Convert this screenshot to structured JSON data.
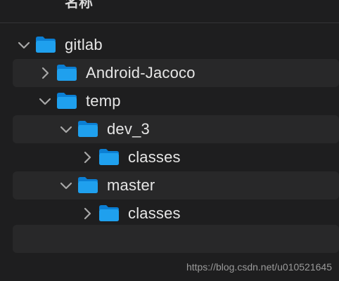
{
  "header": {
    "column_label": "名称"
  },
  "tree": {
    "items": [
      {
        "label": "gitlab",
        "expanded": true,
        "depth": 0
      },
      {
        "label": "Android-Jacoco",
        "expanded": false,
        "depth": 1
      },
      {
        "label": "temp",
        "expanded": true,
        "depth": 1
      },
      {
        "label": "dev_3",
        "expanded": true,
        "depth": 2
      },
      {
        "label": "classes",
        "expanded": false,
        "depth": 3
      },
      {
        "label": "master",
        "expanded": true,
        "depth": 2
      },
      {
        "label": "classes",
        "expanded": false,
        "depth": 3
      }
    ]
  },
  "watermark": {
    "text": "https://blog.csdn.net/u010521645"
  },
  "colors": {
    "background": "#1e1e1f",
    "stripe": "#282829",
    "folder_front": "#1fa0ee",
    "folder_back": "#0b7fd4",
    "text": "#e6e6e6"
  }
}
